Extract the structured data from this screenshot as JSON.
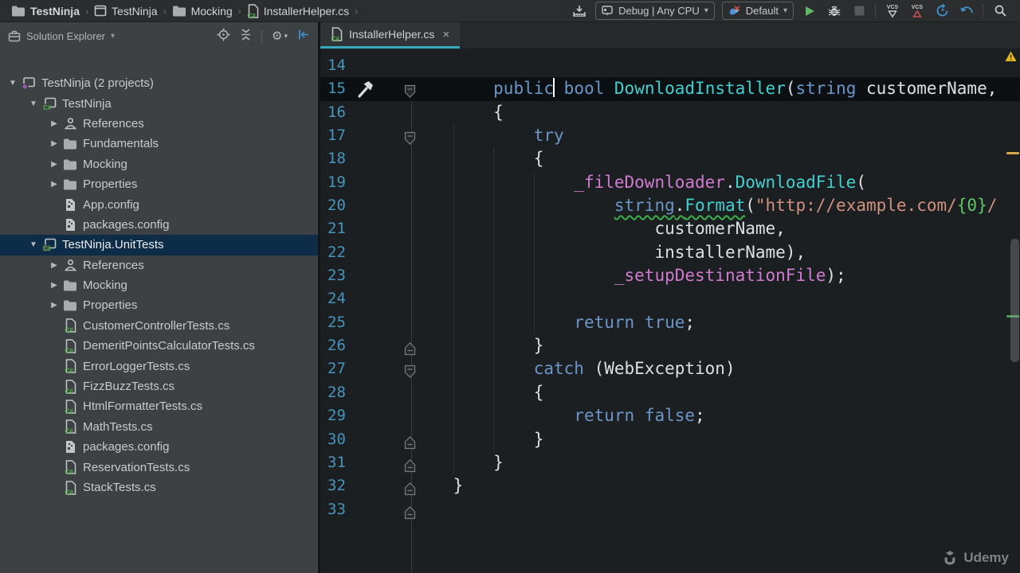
{
  "colors": {
    "accent_tab_underline": "#35aabc",
    "editor_bg": "#1b1f21",
    "sidebar_bg": "#3d4143",
    "selection_bg": "#0d2c47",
    "keyword": "#6c95c8",
    "method": "#45cfcc",
    "field": "#d07ad0",
    "string": "#d0917f",
    "format_placeholder": "#5ec763",
    "line_number": "#4795bc",
    "squiggle_green": "#3fae4a",
    "warning_yellow": "#e8b71c",
    "run_green": "#5fb865",
    "vcs_up_red": "#c75450",
    "undo_blue": "#4090ca"
  },
  "icons": {
    "chevron_down": "▾",
    "breadcrumb_separator": "›",
    "close": "×",
    "tree_expanded": "▼",
    "tree_collapsed": "▶",
    "gear": "⚙"
  },
  "breadcrumbs": [
    {
      "label": "TestNinja",
      "icon": "folder-icon"
    },
    {
      "label": "TestNinja",
      "icon": "project-icon"
    },
    {
      "label": "Mocking",
      "icon": "folder-icon"
    },
    {
      "label": "InstallerHelper.cs",
      "icon": "csharp-file-icon"
    }
  ],
  "toolbar": {
    "run_config": {
      "label": "Debug | Any CPU"
    },
    "test_config": {
      "label": "Default"
    }
  },
  "solution_explorer": {
    "title": "Solution Explorer",
    "items": [
      {
        "label": "TestNinja (2 projects)",
        "level": 0,
        "arrow": "expanded",
        "icon": "solution"
      },
      {
        "label": "TestNinja",
        "level": 1,
        "arrow": "expanded",
        "icon": "csproj"
      },
      {
        "label": "References",
        "level": 2,
        "arrow": "collapsed",
        "icon": "references"
      },
      {
        "label": "Fundamentals",
        "level": 2,
        "arrow": "collapsed",
        "icon": "folder"
      },
      {
        "label": "Mocking",
        "level": 2,
        "arrow": "collapsed",
        "icon": "folder"
      },
      {
        "label": "Properties",
        "level": 2,
        "arrow": "collapsed",
        "icon": "folder"
      },
      {
        "label": "App.config",
        "level": 2,
        "arrow": "none",
        "icon": "config"
      },
      {
        "label": "packages.config",
        "level": 2,
        "arrow": "none",
        "icon": "config"
      },
      {
        "label": "TestNinja.UnitTests",
        "level": 1,
        "arrow": "expanded",
        "icon": "csproj",
        "selected": true
      },
      {
        "label": "References",
        "level": 2,
        "arrow": "collapsed",
        "icon": "references"
      },
      {
        "label": "Mocking",
        "level": 2,
        "arrow": "collapsed",
        "icon": "folder"
      },
      {
        "label": "Properties",
        "level": 2,
        "arrow": "collapsed",
        "icon": "folder"
      },
      {
        "label": "CustomerControllerTests.cs",
        "level": 2,
        "arrow": "none",
        "icon": "csfile"
      },
      {
        "label": "DemeritPointsCalculatorTests.cs",
        "level": 2,
        "arrow": "none",
        "icon": "csfile"
      },
      {
        "label": "ErrorLoggerTests.cs",
        "level": 2,
        "arrow": "none",
        "icon": "csfile"
      },
      {
        "label": "FizzBuzzTests.cs",
        "level": 2,
        "arrow": "none",
        "icon": "csfile"
      },
      {
        "label": "HtmlFormatterTests.cs",
        "level": 2,
        "arrow": "none",
        "icon": "csfile"
      },
      {
        "label": "MathTests.cs",
        "level": 2,
        "arrow": "none",
        "icon": "csfile"
      },
      {
        "label": "packages.config",
        "level": 2,
        "arrow": "none",
        "icon": "config"
      },
      {
        "label": "ReservationTests.cs",
        "level": 2,
        "arrow": "none",
        "icon": "csfile"
      },
      {
        "label": "StackTests.cs",
        "level": 2,
        "arrow": "none",
        "icon": "csfile"
      }
    ]
  },
  "editor": {
    "tab": {
      "label": "InstallerHelper.cs"
    },
    "lines": [
      {
        "num": 14,
        "indent": 0,
        "segments": []
      },
      {
        "num": 15,
        "indent": 8,
        "current": true,
        "gutter_icon": "hammer",
        "fold": "down",
        "segments": [
          [
            "kw",
            "public"
          ],
          [
            "caret",
            ""
          ],
          [
            "plain",
            " "
          ],
          [
            "kw",
            "bool"
          ],
          [
            "plain",
            " "
          ],
          [
            "meth",
            "DownloadInstaller"
          ],
          [
            "plain",
            "("
          ],
          [
            "kw",
            "string"
          ],
          [
            "plain",
            " customerName,"
          ]
        ]
      },
      {
        "num": 16,
        "indent": 8,
        "segments": [
          [
            "plain",
            "{"
          ]
        ]
      },
      {
        "num": 17,
        "indent": 12,
        "fold": "down",
        "segments": [
          [
            "kw",
            "try"
          ]
        ]
      },
      {
        "num": 18,
        "indent": 12,
        "segments": [
          [
            "plain",
            "{"
          ]
        ]
      },
      {
        "num": 19,
        "indent": 16,
        "segments": [
          [
            "field",
            "_fileDownloader"
          ],
          [
            "plain",
            "."
          ],
          [
            "meth",
            "DownloadFile"
          ],
          [
            "plain",
            "("
          ]
        ]
      },
      {
        "num": 20,
        "indent": 20,
        "segments": [
          [
            "kw",
            "string",
            true
          ],
          [
            "plain",
            ".",
            true
          ],
          [
            "meth",
            "Format",
            true
          ],
          [
            "plain",
            "("
          ],
          [
            "str",
            "\"http://example.com/"
          ],
          [
            "fmt",
            "{0}"
          ],
          [
            "str",
            "/"
          ]
        ]
      },
      {
        "num": 21,
        "indent": 24,
        "segments": [
          [
            "plain",
            "customerName,"
          ]
        ]
      },
      {
        "num": 22,
        "indent": 24,
        "segments": [
          [
            "plain",
            "installerName),"
          ]
        ]
      },
      {
        "num": 23,
        "indent": 20,
        "segments": [
          [
            "field",
            "_setupDestinationFile"
          ],
          [
            "plain",
            ");"
          ]
        ]
      },
      {
        "num": 24,
        "indent": 0,
        "segments": []
      },
      {
        "num": 25,
        "indent": 16,
        "segments": [
          [
            "kw",
            "return"
          ],
          [
            "plain",
            " "
          ],
          [
            "kw",
            "true"
          ],
          [
            "plain",
            ";"
          ]
        ]
      },
      {
        "num": 26,
        "indent": 12,
        "fold": "up",
        "segments": [
          [
            "plain",
            "}"
          ]
        ]
      },
      {
        "num": 27,
        "indent": 12,
        "fold": "down",
        "segments": [
          [
            "kw",
            "catch"
          ],
          [
            "plain",
            " (WebException)"
          ]
        ]
      },
      {
        "num": 28,
        "indent": 12,
        "segments": [
          [
            "plain",
            "{"
          ]
        ]
      },
      {
        "num": 29,
        "indent": 16,
        "segments": [
          [
            "kw",
            "return"
          ],
          [
            "plain",
            " "
          ],
          [
            "kw",
            "false"
          ],
          [
            "plain",
            ";"
          ]
        ]
      },
      {
        "num": 30,
        "indent": 12,
        "fold": "up",
        "segments": [
          [
            "plain",
            "}"
          ]
        ]
      },
      {
        "num": 31,
        "indent": 8,
        "fold": "up",
        "segments": [
          [
            "plain",
            "}"
          ]
        ]
      },
      {
        "num": 32,
        "indent": 4,
        "fold": "up",
        "segments": [
          [
            "plain",
            "}"
          ]
        ]
      },
      {
        "num": 33,
        "indent": 0,
        "fold": "up",
        "segments": []
      }
    ]
  },
  "watermark": {
    "label": "Udemy"
  }
}
